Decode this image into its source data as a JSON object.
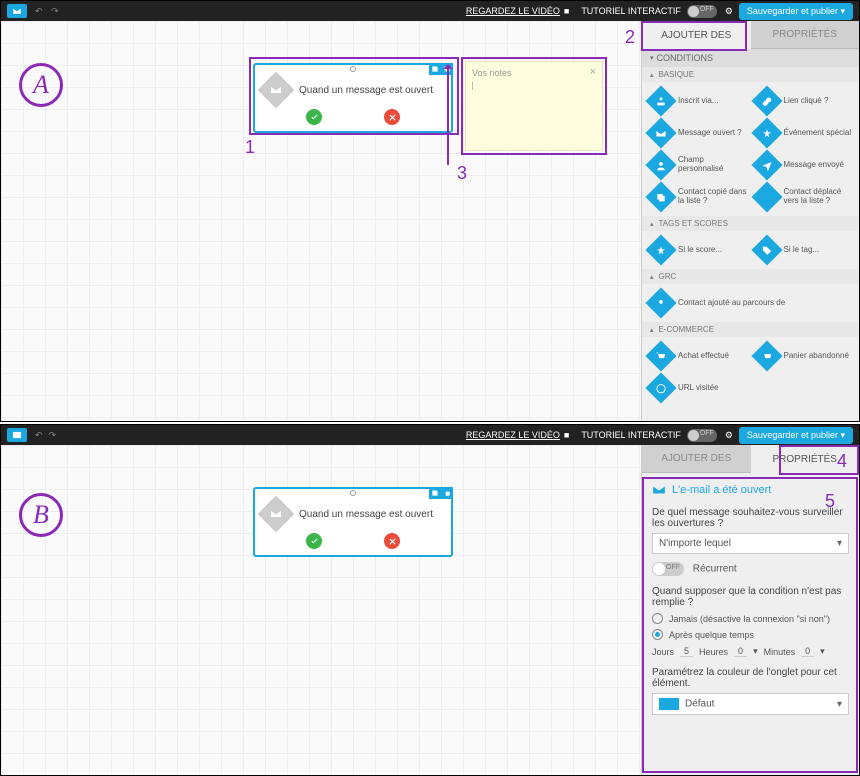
{
  "topbar": {
    "video_link": "REGARDEZ LE VIDÉO",
    "tutorial_label": "TUTORIEL INTERACTIF",
    "toggle_state": "OFF",
    "save_label": "Sauvegarder et publier"
  },
  "tabs": {
    "add": "AJOUTER DES",
    "props": "PROPRIÉTÉS"
  },
  "annotations": {
    "A": "A",
    "B": "B",
    "n1": "1",
    "n2": "2",
    "n3": "3",
    "n4": "4",
    "n5": "5"
  },
  "node": {
    "title": "Quand un message est ouvert"
  },
  "sticky": {
    "title": "Vos notes"
  },
  "sidebar": {
    "section_conditions": "CONDITIONS",
    "sub_basic": "BASIQUE",
    "sub_tags": "TAGS ET SCORES",
    "sub_grc": "GRC",
    "sub_ecom": "E-COMMERCE",
    "items_basic": [
      "Inscrit via...",
      "Lien cliqué ?",
      "Message ouvert ?",
      "Événement spécial",
      "Champ personnalisé",
      "Message envoyé",
      "Contact copié dans la liste ?",
      "Contact déplacé vers la liste ?"
    ],
    "items_tags": [
      "Si le score...",
      "Si le tag..."
    ],
    "items_grc": [
      "Contact ajouté au parcours de"
    ],
    "items_ecom": [
      "Achat effectué",
      "Panier abandonné",
      "URL visitée"
    ]
  },
  "props": {
    "title": "L'e-mail a été ouvert",
    "q1": "De quel message souhaitez-vous surveiller les ouvertures ?",
    "select1": "N'importe lequel",
    "recurrent": "Récurrent",
    "q2": "Quand supposer que la condition n'est pas remplie ?",
    "radio1": "Jamais (désactive la connexion \"si non\")",
    "radio2": "Après quelque temps",
    "days_l": "Jours",
    "days_v": "5",
    "hours_l": "Heures",
    "hours_v": "0",
    "mins_l": "Minutes",
    "mins_v": "0",
    "q3": "Paramétrez la couleur de l'onglet pour cet élément.",
    "color_label": "Défaut"
  }
}
